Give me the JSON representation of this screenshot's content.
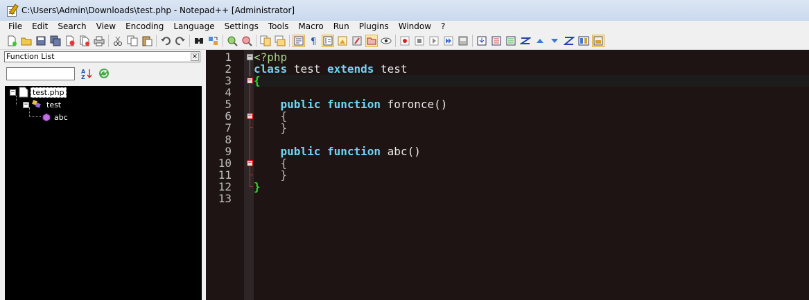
{
  "window": {
    "title": "C:\\Users\\Admin\\Downloads\\test.php - Notepad++ [Administrator]",
    "icon": "notepad-icon"
  },
  "menu": [
    "File",
    "Edit",
    "Search",
    "View",
    "Encoding",
    "Language",
    "Settings",
    "Tools",
    "Macro",
    "Run",
    "Plugins",
    "Window",
    "?"
  ],
  "toolbar": {
    "buttons": [
      "new-icon",
      "open-icon",
      "save-icon",
      "save-all-icon",
      "close-icon",
      "close-all-icon",
      "print-icon",
      "cut-icon",
      "copy-icon",
      "paste-icon",
      "undo-icon",
      "redo-icon",
      "find-icon",
      "replace-icon",
      "zoom-in-icon",
      "zoom-out-icon",
      "sync-vertical-icon",
      "sync-horizontal-icon",
      "word-wrap-icon",
      "show-all-chars-icon",
      "indent-guide-icon",
      "document-map-icon",
      "function-list-icon",
      "folder-as-workspace-icon",
      "monitoring-icon",
      "record-macro-icon",
      "stop-macro-icon",
      "play-macro-icon",
      "run-macro-multiple-icon",
      "save-macro-icon",
      "plugin-1-icon",
      "plugin-2-icon",
      "plugin-3-icon",
      "plugin-4-icon",
      "plugin-5-icon",
      "plugin-6-icon",
      "plugin-7-icon",
      "plugin-8-icon",
      "plugin-9-icon"
    ]
  },
  "function_list": {
    "title": "Function List",
    "close_label": "×",
    "search_value": "",
    "sort_icon": "sort-az-icon",
    "reload_icon": "reload-icon",
    "tree": {
      "file": "test.php",
      "class": "test",
      "method": "abc"
    }
  },
  "editor": {
    "line_numbers": [
      "1",
      "2",
      "3",
      "4",
      "5",
      "6",
      "7",
      "8",
      "9",
      "10",
      "11",
      "12",
      "13"
    ],
    "lines": {
      "l1": "<?php",
      "l2_kw1": "class",
      "l2_t1": " test ",
      "l2_kw2": "extends",
      "l2_t2": " test",
      "l3": "{",
      "l5_indent": "    ",
      "l5_kw1": "public",
      "l5_kw2": "function",
      "l5_t": " foronce()",
      "l6": "    {",
      "l7": "    }",
      "l9_indent": "    ",
      "l9_kw1": "public",
      "l9_kw2": "function",
      "l9_t": " abc()",
      "l10": "    {",
      "l11": "    }",
      "l12": "}"
    },
    "colors": {
      "background": "#1e1414",
      "keyword": "#6fd6f5",
      "brace": "#2bd92b",
      "php_tag": "#a8d68a"
    }
  }
}
